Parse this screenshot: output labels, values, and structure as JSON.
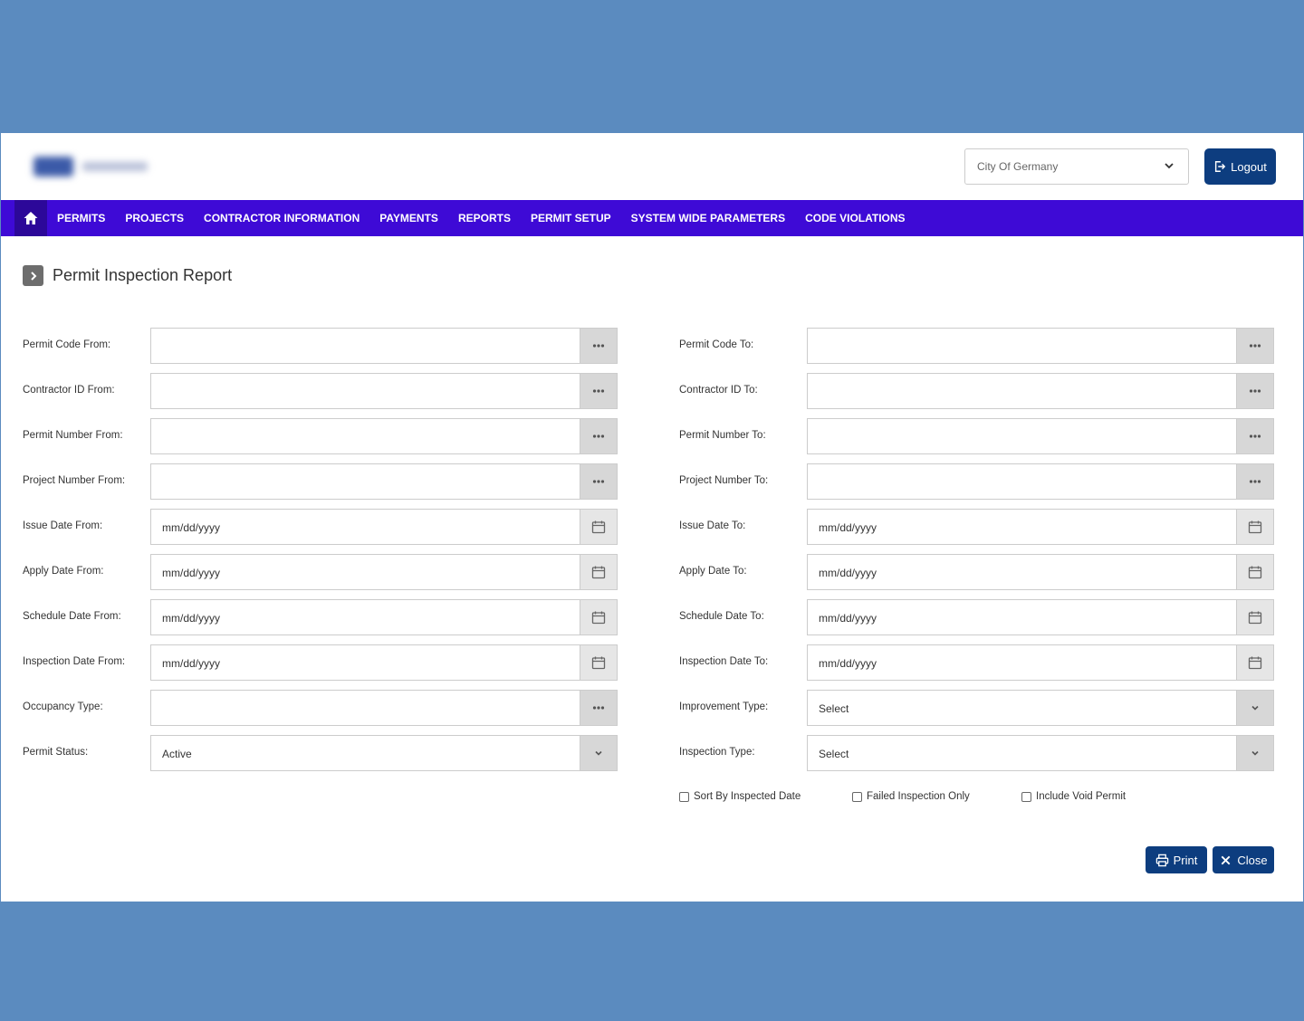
{
  "header": {
    "city_select": "City Of Germany",
    "logout_label": "Logout"
  },
  "nav": {
    "items": [
      "PERMITS",
      "PROJECTS",
      "CONTRACTOR INFORMATION",
      "PAYMENTS",
      "REPORTS",
      "PERMIT SETUP",
      "SYSTEM WIDE PARAMETERS",
      "CODE VIOLATIONS"
    ]
  },
  "page": {
    "title": "Permit Inspection Report"
  },
  "form": {
    "left": [
      {
        "label": "Permit Code From:",
        "value": "",
        "addon": "ellipsis"
      },
      {
        "label": "Contractor ID From:",
        "value": "",
        "addon": "ellipsis"
      },
      {
        "label": "Permit Number From:",
        "value": "",
        "addon": "ellipsis"
      },
      {
        "label": "Project Number From:",
        "value": "",
        "addon": "ellipsis"
      },
      {
        "label": "Issue Date From:",
        "value": "mm/dd/yyyy",
        "addon": "calendar"
      },
      {
        "label": "Apply Date From:",
        "value": "mm/dd/yyyy",
        "addon": "calendar"
      },
      {
        "label": "Schedule Date From:",
        "value": "mm/dd/yyyy",
        "addon": "calendar"
      },
      {
        "label": "Inspection Date From:",
        "value": "mm/dd/yyyy",
        "addon": "calendar"
      },
      {
        "label": "Occupancy Type:",
        "value": "",
        "addon": "ellipsis"
      },
      {
        "label": "Permit Status:",
        "value": "Active",
        "addon": "chevron"
      }
    ],
    "right": [
      {
        "label": "Permit Code To:",
        "value": "",
        "addon": "ellipsis"
      },
      {
        "label": "Contractor ID To:",
        "value": "",
        "addon": "ellipsis"
      },
      {
        "label": "Permit Number To:",
        "value": "",
        "addon": "ellipsis"
      },
      {
        "label": "Project Number To:",
        "value": "",
        "addon": "ellipsis"
      },
      {
        "label": "Issue Date To:",
        "value": "mm/dd/yyyy",
        "addon": "calendar"
      },
      {
        "label": "Apply Date To:",
        "value": "mm/dd/yyyy",
        "addon": "calendar"
      },
      {
        "label": "Schedule Date To:",
        "value": "mm/dd/yyyy",
        "addon": "calendar"
      },
      {
        "label": "Inspection Date To:",
        "value": "mm/dd/yyyy",
        "addon": "calendar"
      },
      {
        "label": "Improvement Type:",
        "value": "Select",
        "addon": "chevron"
      },
      {
        "label": "Inspection Type:",
        "value": "Select",
        "addon": "chevron"
      }
    ],
    "checkboxes": [
      {
        "label": "Sort By Inspected Date",
        "checked": false
      },
      {
        "label": "Failed Inspection Only",
        "checked": false
      },
      {
        "label": "Include Void Permit",
        "checked": false
      }
    ]
  },
  "actions": {
    "print_label": "Print",
    "close_label": "Close"
  },
  "colors": {
    "background": "#5b8bbf",
    "nav": "#3e0ad6",
    "primary_button": "#0d3d7f"
  }
}
